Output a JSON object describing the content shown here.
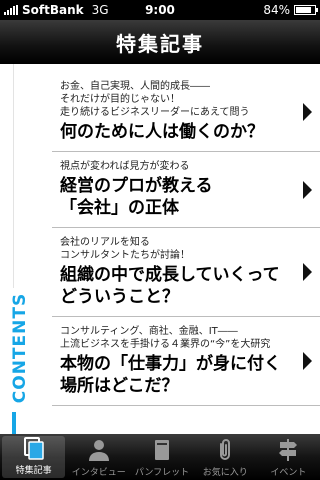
{
  "status_bar": {
    "carrier": "SoftBank",
    "network": "3G",
    "time": "9:00",
    "battery_text": "84%",
    "battery_level": 0.84
  },
  "nav": {
    "title": "特集記事"
  },
  "side_label": "CONTENTS",
  "articles": [
    {
      "kicker": [
        "お金、自己実現、人間的成長――",
        "それだけが目的じゃない！",
        "走り続けるビジネスリーダーにあえて問う"
      ],
      "title": [
        "何のために人は働くのか？"
      ]
    },
    {
      "kicker": [
        "視点が変われば見方が変わる"
      ],
      "title": [
        "経営のプロが教える",
        "「会社」の正体"
      ]
    },
    {
      "kicker": [
        "会社のリアルを知る",
        "コンサルタントたちが討論！"
      ],
      "title": [
        "組織の中で成長していくって",
        "どういうこと？"
      ]
    },
    {
      "kicker": [
        "コンサルティング、商社、金融、IT――",
        "上流ビジネスを手掛ける４業界の“今”を大研究"
      ],
      "title": [
        "本物の「仕事力」が身に付く",
        "場所はどこだ？"
      ]
    }
  ],
  "tabs": [
    {
      "label": "特集記事",
      "icon": "articles-icon",
      "active": true
    },
    {
      "label": "インタビュー",
      "icon": "person-icon",
      "active": false
    },
    {
      "label": "パンフレット",
      "icon": "pamphlet-icon",
      "active": false
    },
    {
      "label": "お気に入り",
      "icon": "paperclip-icon",
      "active": false
    },
    {
      "label": "イベント",
      "icon": "signpost-icon",
      "active": false
    }
  ],
  "colors": {
    "accent": "#16a6e6"
  }
}
